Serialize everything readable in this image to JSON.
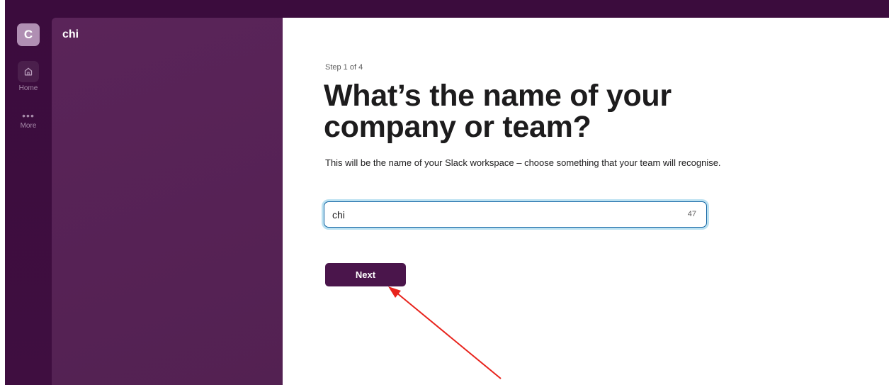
{
  "workspace": {
    "initial": "C",
    "name": "chi"
  },
  "rail": {
    "home_label": "Home",
    "home_icon": "home-icon",
    "more_label": "More",
    "more_icon": "more-dots-icon"
  },
  "form": {
    "step": "Step 1 of 4",
    "title": "What’s the name of your company or team?",
    "description": "This will be the name of your Slack workspace – choose something that your team will recognise.",
    "input_value": "chi",
    "char_counter": "47",
    "next_label": "Next"
  },
  "colors": {
    "brand_aubergine": "#4a154b",
    "focus_ring": "#1264a3",
    "annotation_arrow": "#e8231c"
  }
}
